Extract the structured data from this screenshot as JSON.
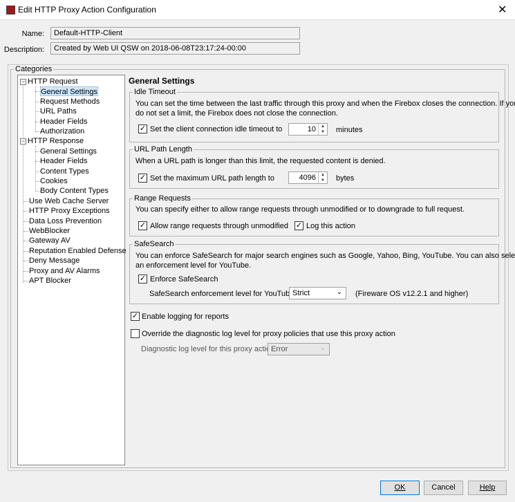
{
  "window": {
    "title": "Edit HTTP Proxy Action Configuration",
    "close_icon": "close-icon",
    "app_icon": "firebox-icon"
  },
  "form": {
    "name_label": "Name:",
    "name_value": "Default-HTTP-Client",
    "description_label": "Description:",
    "description_value": "Created by Web UI QSW on 2018-06-08T23:17:24-00:00"
  },
  "categories": {
    "title": "Categories",
    "tree": [
      {
        "label": "HTTP Request",
        "expanded": true,
        "children": [
          "General Settings",
          "Request Methods",
          "URL Paths",
          "Header Fields",
          "Authorization"
        ]
      },
      {
        "label": "HTTP Response",
        "expanded": true,
        "children": [
          "General Settings",
          "Header Fields",
          "Content Types",
          "Cookies",
          "Body Content Types"
        ]
      },
      {
        "label": "Use Web Cache Server"
      },
      {
        "label": "HTTP Proxy Exceptions"
      },
      {
        "label": "Data Loss Prevention"
      },
      {
        "label": "WebBlocker"
      },
      {
        "label": "Gateway AV"
      },
      {
        "label": "Reputation Enabled Defense"
      },
      {
        "label": "Deny Message"
      },
      {
        "label": "Proxy and AV Alarms"
      },
      {
        "label": "APT Blocker"
      }
    ],
    "selected": "HTTP Request > General Settings"
  },
  "main": {
    "heading": "General Settings",
    "idle_timeout": {
      "title": "Idle Timeout",
      "desc1": "You can set the time between the last traffic through this proxy and when the Firebox closes the connection. If you",
      "desc2": "do not set a limit, the Firebox does not close the connection.",
      "checkbox_label": "Set the client connection idle timeout to",
      "checked": true,
      "value": "10",
      "unit": "minutes"
    },
    "url_path": {
      "title": "URL Path Length",
      "desc": "When a URL path is longer than this limit, the requested content is denied.",
      "checkbox_label": "Set the maximum URL path length to",
      "checked": true,
      "value": "4096",
      "unit": "bytes"
    },
    "range": {
      "title": "Range Requests",
      "desc": "You can specify either to allow range requests through unmodified or to downgrade to full request.",
      "allow_label": "Allow range requests through unmodified",
      "allow_checked": true,
      "log_label": "Log this action",
      "log_checked": true
    },
    "safesearch": {
      "title": "SafeSearch",
      "desc1": "You can enforce SafeSearch for major search engines such as Google, Yahoo, Bing, YouTube. You can also select",
      "desc2": "an enforcement level for YouTube.",
      "enforce_label": "Enforce SafeSearch",
      "enforce_checked": true,
      "level_label": "SafeSearch enforcement level for YouTube:",
      "level_value": "Strict",
      "note": "(Fireware OS v12.2.1 and higher)"
    },
    "logging_label": "Enable logging for reports",
    "logging_checked": true,
    "override_label": "Override the diagnostic log level for proxy policies that use this proxy action",
    "override_checked": false,
    "diag_label": "Diagnostic log level for this proxy action",
    "diag_value": "Error"
  },
  "buttons": {
    "ok": "OK",
    "cancel": "Cancel",
    "help": "Help"
  }
}
